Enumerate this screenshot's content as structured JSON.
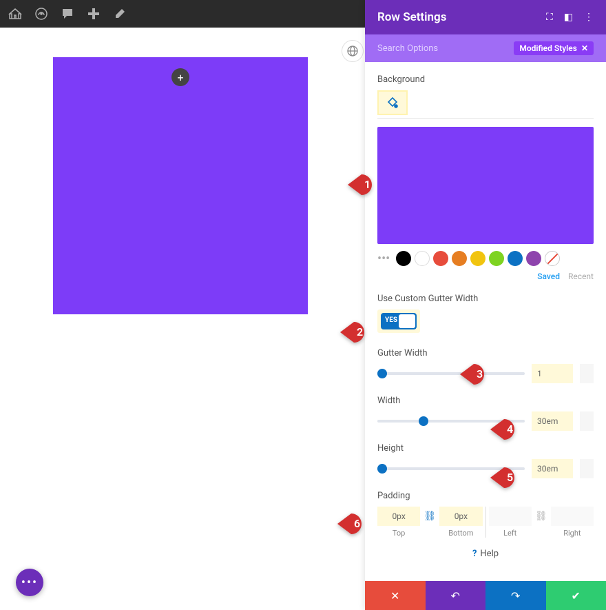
{
  "panel": {
    "title": "Row Settings",
    "search_placeholder": "Search Options",
    "modified_badge": "Modified Styles"
  },
  "background": {
    "label": "Background",
    "saved_tab": "Saved",
    "recent_tab": "Recent",
    "swatches": [
      "#000000",
      "#ffffff",
      "#e74c3c",
      "#e67e22",
      "#f1c40f",
      "#7ed321",
      "#0c71c3",
      "#8e44ad"
    ]
  },
  "gutter_toggle": {
    "label": "Use Custom Gutter Width",
    "state": "YES"
  },
  "gutter_width": {
    "label": "Gutter Width",
    "value": "1"
  },
  "width": {
    "label": "Width",
    "value": "30em"
  },
  "height": {
    "label": "Height",
    "value": "30em"
  },
  "padding": {
    "label": "Padding",
    "top": {
      "value": "0px",
      "label": "Top"
    },
    "bottom": {
      "value": "0px",
      "label": "Bottom"
    },
    "left": {
      "value": "",
      "label": "Left"
    },
    "right": {
      "value": "",
      "label": "Right"
    }
  },
  "help": "Help",
  "callouts": [
    "1",
    "2",
    "3",
    "4",
    "5",
    "6"
  ]
}
